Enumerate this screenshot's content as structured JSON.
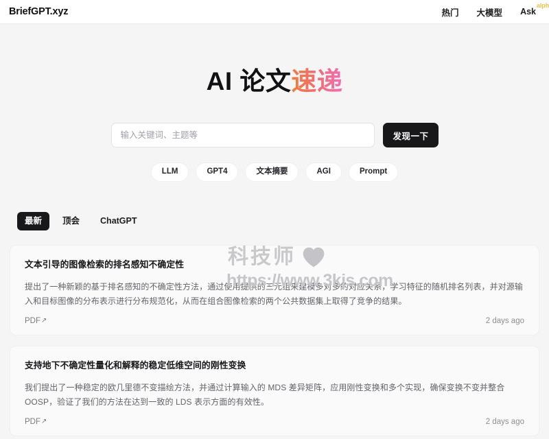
{
  "header": {
    "brand": "BriefGPT.xyz",
    "nav": [
      {
        "label": "热门",
        "name": "nav-link-hot"
      },
      {
        "label": "大模型",
        "name": "nav-link-llm"
      },
      {
        "label": "Ask",
        "name": "nav-link-ask",
        "badge": "alpha"
      }
    ],
    "badge_color": "#e8c24a"
  },
  "hero": {
    "title_main": "AI 论文",
    "title_accent": "速递",
    "accent_gradient_from": "#f07d3d",
    "accent_gradient_to": "#ef6fb4"
  },
  "search": {
    "placeholder": "输入关键词、主题等",
    "value": "",
    "button_label": "发现一下"
  },
  "tags": [
    {
      "label": "LLM"
    },
    {
      "label": "GPT4"
    },
    {
      "label": "文本摘要"
    },
    {
      "label": "AGI"
    },
    {
      "label": "Prompt"
    }
  ],
  "tabs": [
    {
      "label": "最新",
      "active": true
    },
    {
      "label": "顶会",
      "active": false
    },
    {
      "label": "ChatGPT",
      "active": false
    }
  ],
  "papers": [
    {
      "title": "文本引导的图像检索的排名感知不确定性",
      "abstract": "提出了一种新颖的基于排名感知的不确定性方法，通过使用提供的三元组来建模多对多的对应关系，学习特征的随机排名列表，并对源输入和目标图像的分布表示进行分布规范化，从而在组合图像检索的两个公共数据集上取得了竞争的结果。",
      "pdf_label": "PDF",
      "pdf_icon": "external-link-arrow-icon",
      "date": "2 days ago"
    },
    {
      "title": "支持地下不确定性量化和解释的稳定低维空间的刚性变换",
      "abstract": "我们提出了一种稳定的欧几里德不变描绘方法，并通过计算输入的 MDS 差异矩阵，应用刚性变换和多个实现，确保变换不变并整合 OOSP，验证了我们的方法在达到一致的 LDS 表示方面的有效性。",
      "pdf_label": "PDF",
      "pdf_icon": "external-link-arrow-icon",
      "date": "2 days ago"
    }
  ],
  "watermark": {
    "text": "科技师",
    "icon": "heart-icon",
    "url": "https://www.3kjs.com",
    "color": "#c9c9cc"
  }
}
